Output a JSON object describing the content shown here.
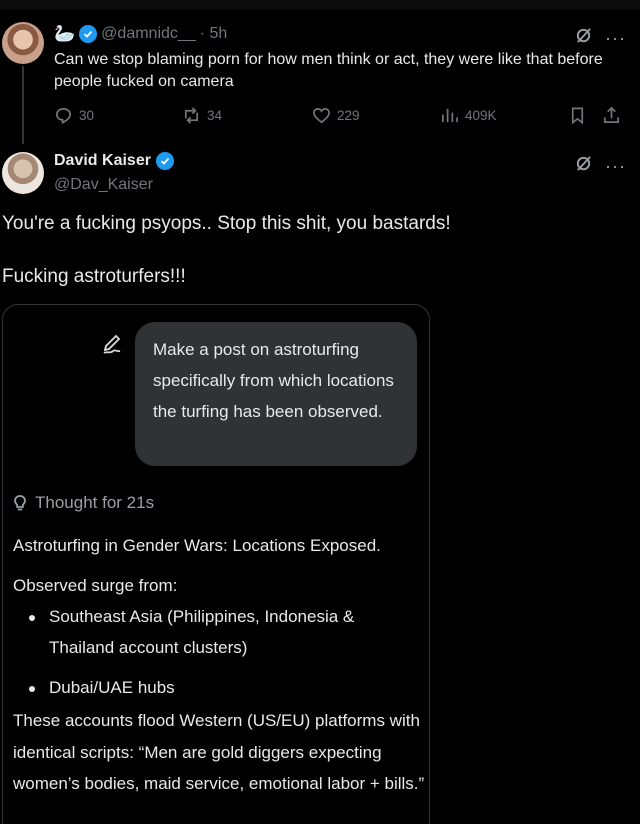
{
  "parent_tweet": {
    "emoji": "🦢",
    "handle": "@damnidc__",
    "time": "· 5h",
    "text": "Can we stop blaming porn for how men think or act, they were like that before people fucked on camera",
    "replies": "30",
    "reposts": "34",
    "likes": "229",
    "views": "409K"
  },
  "main_tweet": {
    "name": "David Kaiser",
    "handle": "@Dav_Kaiser",
    "line1": "You're a fucking psyops.. Stop this shit, you bastards!",
    "line2": "Fucking astroturfers!!!"
  },
  "card": {
    "prompt": "Make a post on astroturfing specifically from which locations the turfing has been observed.",
    "thought": "Thought for 21s",
    "heading": "Astroturfing in Gender Wars: Locations Exposed.",
    "observed": "Observed surge from:",
    "bullets": [
      "Southeast Asia (Philippines, Indonesia & Thailand account clusters)",
      "Dubai/UAE hubs"
    ],
    "paragraph": "These accounts flood Western (US/EU) platforms with identical scripts: “Men are gold diggers expecting women’s bodies, maid service, emotional labor + bills.”"
  },
  "colors": {
    "accent": "#1d9bf0",
    "muted": "#71767b",
    "text": "#e7e9ea",
    "bubble": "#2f3336"
  },
  "icons": [
    "swan-emoji",
    "verified-badge-icon",
    "grok-icon",
    "more-icon",
    "reply-icon",
    "repost-icon",
    "like-icon",
    "views-icon",
    "bookmark-icon",
    "share-icon",
    "pen-icon",
    "lightbulb-icon"
  ]
}
